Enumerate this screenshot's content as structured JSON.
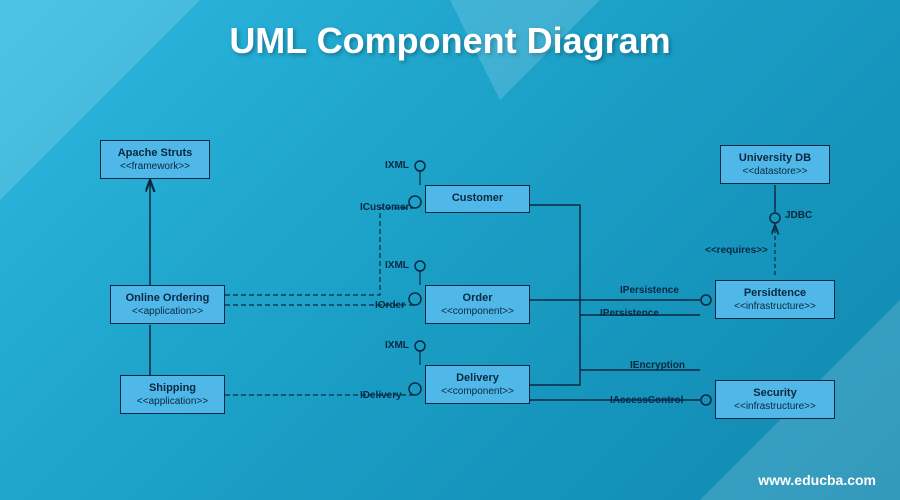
{
  "title": "UML Component Diagram",
  "footer": "www.educba.com",
  "components": {
    "apache": {
      "name": "Apache Struts",
      "stereo": "<<framework>>"
    },
    "ordering": {
      "name": "Online Ordering",
      "stereo": "<<application>>"
    },
    "shipping": {
      "name": "Shipping",
      "stereo": "<<application>>"
    },
    "customer": {
      "name": "Customer",
      "stereo": ""
    },
    "order": {
      "name": "Order",
      "stereo": "<<component>>"
    },
    "delivery": {
      "name": "Delivery",
      "stereo": "<<component>>"
    },
    "university": {
      "name": "University DB",
      "stereo": "<<datastore>>"
    },
    "persistence": {
      "name": "Persidtence",
      "stereo": "<<infrastructure>>"
    },
    "security": {
      "name": "Security",
      "stereo": "<<infrastructure>>"
    }
  },
  "labels": {
    "ixml1": "IXML",
    "ixml2": "IXML",
    "ixml3": "IXML",
    "icustomer": "ICustomer",
    "iorder": "IOrder",
    "idelivery": "IDelivery",
    "ipersistence1": "IPersistence",
    "ipersistence2": "IPersistence",
    "iencryption": "IEncryption",
    "iaccesscontrol": "IAccessControl",
    "jdbc": "JDBC",
    "requires": "<<requires>>"
  }
}
